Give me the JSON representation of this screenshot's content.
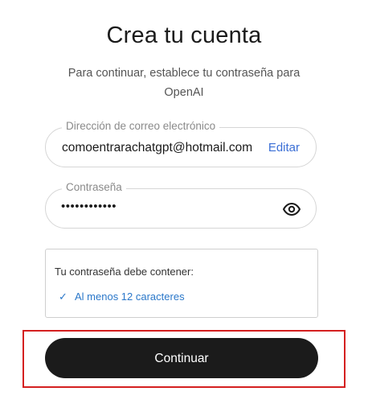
{
  "header": {
    "title": "Crea tu cuenta",
    "subtitle": "Para continuar, establece tu contraseña para OpenAI"
  },
  "email_field": {
    "label": "Dirección de correo electrónico",
    "value": "comoentrarachatgpt@hotmail.com",
    "edit_label": "Editar"
  },
  "password_field": {
    "label": "Contraseña",
    "value": "••••••••••••",
    "toggle_icon": "eye-icon"
  },
  "requirements": {
    "title": "Tu contraseña debe contener:",
    "items": [
      {
        "check": "✓",
        "text": "Al menos 12 caracteres",
        "met": true
      }
    ]
  },
  "actions": {
    "continue_label": "Continuar"
  },
  "colors": {
    "primary_button": "#1b1b1b",
    "link": "#3b6fd6",
    "requirement_met": "#2a77c9",
    "highlight": "#d42020"
  }
}
